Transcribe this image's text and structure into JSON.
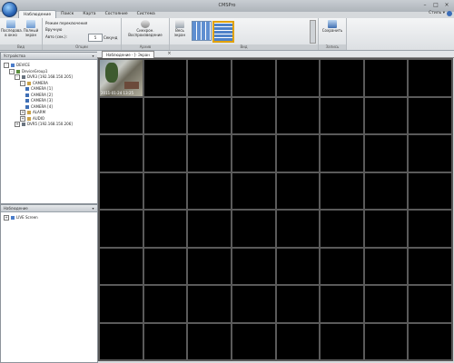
{
  "window": {
    "title": "CMSPro",
    "buttons": [
      "–",
      "□",
      "×"
    ]
  },
  "ribbon": {
    "tabs": [
      "Наблюдение",
      "Поиск",
      "Карта",
      "Состояние",
      "Система"
    ],
    "active_tab": 0,
    "style_label": "Стиль ▾",
    "groups": {
      "view": {
        "label": "Вид",
        "btn1": "Последова. в окно",
        "btn2": "Полный экран"
      },
      "options": {
        "label": "Опции",
        "line1": "Режим переключения",
        "line2": "Вручную",
        "line3": "Авто (сек.):",
        "spin_value": "5",
        "spin_unit": "Секунд"
      },
      "archive": {
        "label": "Архив",
        "btn": "Синхрон. Воспроизведение"
      },
      "layout": {
        "label": "Вид",
        "btn": "Весь экран"
      },
      "record": {
        "label": "Запись",
        "btn": "Сохранить"
      }
    }
  },
  "devices_pane": {
    "title": "Устройства",
    "tree": [
      {
        "label": "DEVICE",
        "level": 0,
        "exp": "-"
      },
      {
        "label": "DeviceGroup1",
        "level": 1,
        "exp": "-"
      },
      {
        "label": "DVR3 [192.168.150.205]",
        "level": 2,
        "exp": "-"
      },
      {
        "label": "CAMERA",
        "level": 3,
        "exp": "-"
      },
      {
        "label": "CAMERA [1]",
        "level": 4,
        "exp": ""
      },
      {
        "label": "CAMERA [2]",
        "level": 4,
        "exp": ""
      },
      {
        "label": "CAMERA [3]",
        "level": 4,
        "exp": ""
      },
      {
        "label": "CAMERA [4]",
        "level": 4,
        "exp": ""
      },
      {
        "label": "ALARM",
        "level": 3,
        "exp": "+"
      },
      {
        "label": "AUDIO",
        "level": 3,
        "exp": "+"
      },
      {
        "label": "DVR5 [192.168.150.206]",
        "level": 2,
        "exp": "+"
      }
    ]
  },
  "monitor_pane": {
    "title": "Наблюдение",
    "tree": [
      {
        "label": "LIVE Screen",
        "level": 0,
        "exp": "+"
      }
    ]
  },
  "document": {
    "tab_label": "Наблюдение - [- Экран",
    "camera_stamp": "2011-01-24 13:25"
  }
}
